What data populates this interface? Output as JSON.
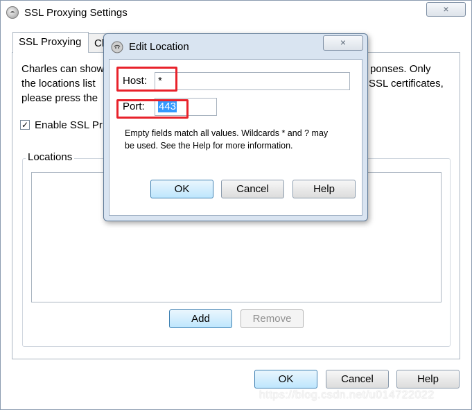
{
  "window": {
    "title": "SSL Proxying Settings",
    "close_icon": "×"
  },
  "tabs": [
    {
      "label": "SSL Proxying"
    },
    {
      "label": "Cli"
    }
  ],
  "description": {
    "line1_left": "Charles can show",
    "line1_right": "ponses. Only",
    "line2_left": "the locations list",
    "line2_right": "SSL certificates,",
    "line3_left": "please press the"
  },
  "enable_ssl": {
    "label": "Enable SSL Pr",
    "checked_mark": "✓"
  },
  "locations": {
    "label": "Locations",
    "add_label": "Add",
    "remove_label": "Remove"
  },
  "main_buttons": {
    "ok_label": "OK",
    "cancel_label": "Cancel",
    "help_label": "Help"
  },
  "dialog": {
    "title": "Edit Location",
    "close_icon": "×",
    "host_label": "Host:",
    "host_value": "*",
    "port_label": "Port:",
    "port_value": "443",
    "help_line1": "Empty fields match all values. Wildcards * and ? may",
    "help_line2": "be used. See the Help for more information.",
    "ok_label": "OK",
    "cancel_label": "Cancel",
    "help_label": "Help"
  },
  "watermark": "https://blog.csdn.net/u014722022",
  "colors": {
    "highlight": "#e8222b",
    "selection": "#3399ff",
    "default_button": "#bee6fd"
  }
}
